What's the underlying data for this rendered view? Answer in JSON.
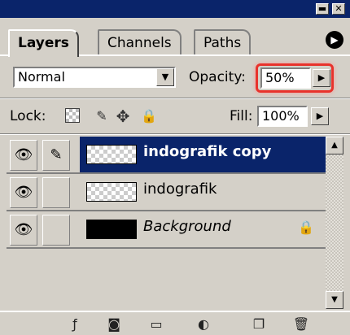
{
  "window": {
    "minimize_glyph": "▬",
    "close_glyph": "✕"
  },
  "tabs": [
    {
      "label": "Layers",
      "active": true
    },
    {
      "label": "Channels",
      "active": false
    },
    {
      "label": "Paths",
      "active": false
    }
  ],
  "panel_menu_icon": "arrow-right-circle-icon",
  "blend_mode": {
    "value": "Normal"
  },
  "opacity": {
    "label": "Opacity:",
    "value": "50%"
  },
  "lock": {
    "label": "Lock:"
  },
  "fill": {
    "label": "Fill:",
    "value": "100%"
  },
  "layers": [
    {
      "name": "indografik copy",
      "selected": true,
      "thumb": "transparent",
      "brush": true
    },
    {
      "name": "indografik",
      "selected": false,
      "thumb": "transparent",
      "brush": false
    },
    {
      "name": "Background",
      "selected": false,
      "thumb": "black",
      "locked": true
    }
  ],
  "highlight_color": "#e8322c",
  "selection_color": "#0a246a"
}
